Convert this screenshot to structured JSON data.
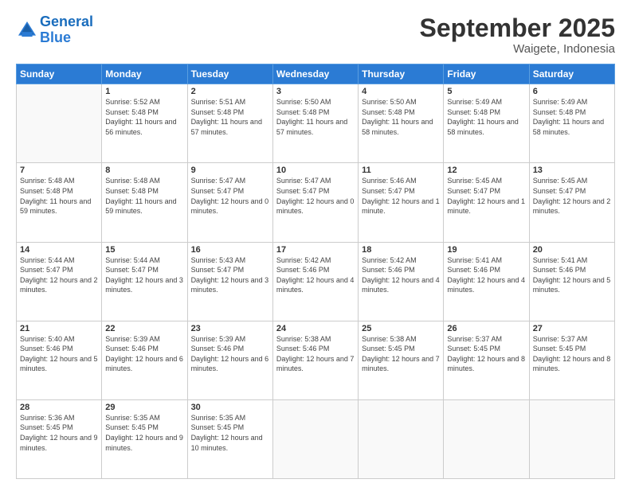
{
  "logo": {
    "line1": "General",
    "line2": "Blue"
  },
  "title": "September 2025",
  "subtitle": "Waigete, Indonesia",
  "header_days": [
    "Sunday",
    "Monday",
    "Tuesday",
    "Wednesday",
    "Thursday",
    "Friday",
    "Saturday"
  ],
  "weeks": [
    [
      {
        "day": "",
        "info": ""
      },
      {
        "day": "1",
        "info": "Sunrise: 5:52 AM\nSunset: 5:48 PM\nDaylight: 11 hours\nand 56 minutes."
      },
      {
        "day": "2",
        "info": "Sunrise: 5:51 AM\nSunset: 5:48 PM\nDaylight: 11 hours\nand 57 minutes."
      },
      {
        "day": "3",
        "info": "Sunrise: 5:50 AM\nSunset: 5:48 PM\nDaylight: 11 hours\nand 57 minutes."
      },
      {
        "day": "4",
        "info": "Sunrise: 5:50 AM\nSunset: 5:48 PM\nDaylight: 11 hours\nand 58 minutes."
      },
      {
        "day": "5",
        "info": "Sunrise: 5:49 AM\nSunset: 5:48 PM\nDaylight: 11 hours\nand 58 minutes."
      },
      {
        "day": "6",
        "info": "Sunrise: 5:49 AM\nSunset: 5:48 PM\nDaylight: 11 hours\nand 58 minutes."
      }
    ],
    [
      {
        "day": "7",
        "info": "Sunrise: 5:48 AM\nSunset: 5:48 PM\nDaylight: 11 hours\nand 59 minutes."
      },
      {
        "day": "8",
        "info": "Sunrise: 5:48 AM\nSunset: 5:48 PM\nDaylight: 11 hours\nand 59 minutes."
      },
      {
        "day": "9",
        "info": "Sunrise: 5:47 AM\nSunset: 5:47 PM\nDaylight: 12 hours\nand 0 minutes."
      },
      {
        "day": "10",
        "info": "Sunrise: 5:47 AM\nSunset: 5:47 PM\nDaylight: 12 hours\nand 0 minutes."
      },
      {
        "day": "11",
        "info": "Sunrise: 5:46 AM\nSunset: 5:47 PM\nDaylight: 12 hours\nand 1 minute."
      },
      {
        "day": "12",
        "info": "Sunrise: 5:45 AM\nSunset: 5:47 PM\nDaylight: 12 hours\nand 1 minute."
      },
      {
        "day": "13",
        "info": "Sunrise: 5:45 AM\nSunset: 5:47 PM\nDaylight: 12 hours\nand 2 minutes."
      }
    ],
    [
      {
        "day": "14",
        "info": "Sunrise: 5:44 AM\nSunset: 5:47 PM\nDaylight: 12 hours\nand 2 minutes."
      },
      {
        "day": "15",
        "info": "Sunrise: 5:44 AM\nSunset: 5:47 PM\nDaylight: 12 hours\nand 3 minutes."
      },
      {
        "day": "16",
        "info": "Sunrise: 5:43 AM\nSunset: 5:47 PM\nDaylight: 12 hours\nand 3 minutes."
      },
      {
        "day": "17",
        "info": "Sunrise: 5:42 AM\nSunset: 5:46 PM\nDaylight: 12 hours\nand 4 minutes."
      },
      {
        "day": "18",
        "info": "Sunrise: 5:42 AM\nSunset: 5:46 PM\nDaylight: 12 hours\nand 4 minutes."
      },
      {
        "day": "19",
        "info": "Sunrise: 5:41 AM\nSunset: 5:46 PM\nDaylight: 12 hours\nand 4 minutes."
      },
      {
        "day": "20",
        "info": "Sunrise: 5:41 AM\nSunset: 5:46 PM\nDaylight: 12 hours\nand 5 minutes."
      }
    ],
    [
      {
        "day": "21",
        "info": "Sunrise: 5:40 AM\nSunset: 5:46 PM\nDaylight: 12 hours\nand 5 minutes."
      },
      {
        "day": "22",
        "info": "Sunrise: 5:39 AM\nSunset: 5:46 PM\nDaylight: 12 hours\nand 6 minutes."
      },
      {
        "day": "23",
        "info": "Sunrise: 5:39 AM\nSunset: 5:46 PM\nDaylight: 12 hours\nand 6 minutes."
      },
      {
        "day": "24",
        "info": "Sunrise: 5:38 AM\nSunset: 5:46 PM\nDaylight: 12 hours\nand 7 minutes."
      },
      {
        "day": "25",
        "info": "Sunrise: 5:38 AM\nSunset: 5:45 PM\nDaylight: 12 hours\nand 7 minutes."
      },
      {
        "day": "26",
        "info": "Sunrise: 5:37 AM\nSunset: 5:45 PM\nDaylight: 12 hours\nand 8 minutes."
      },
      {
        "day": "27",
        "info": "Sunrise: 5:37 AM\nSunset: 5:45 PM\nDaylight: 12 hours\nand 8 minutes."
      }
    ],
    [
      {
        "day": "28",
        "info": "Sunrise: 5:36 AM\nSunset: 5:45 PM\nDaylight: 12 hours\nand 9 minutes."
      },
      {
        "day": "29",
        "info": "Sunrise: 5:35 AM\nSunset: 5:45 PM\nDaylight: 12 hours\nand 9 minutes."
      },
      {
        "day": "30",
        "info": "Sunrise: 5:35 AM\nSunset: 5:45 PM\nDaylight: 12 hours\nand 10 minutes."
      },
      {
        "day": "",
        "info": ""
      },
      {
        "day": "",
        "info": ""
      },
      {
        "day": "",
        "info": ""
      },
      {
        "day": "",
        "info": ""
      }
    ]
  ]
}
